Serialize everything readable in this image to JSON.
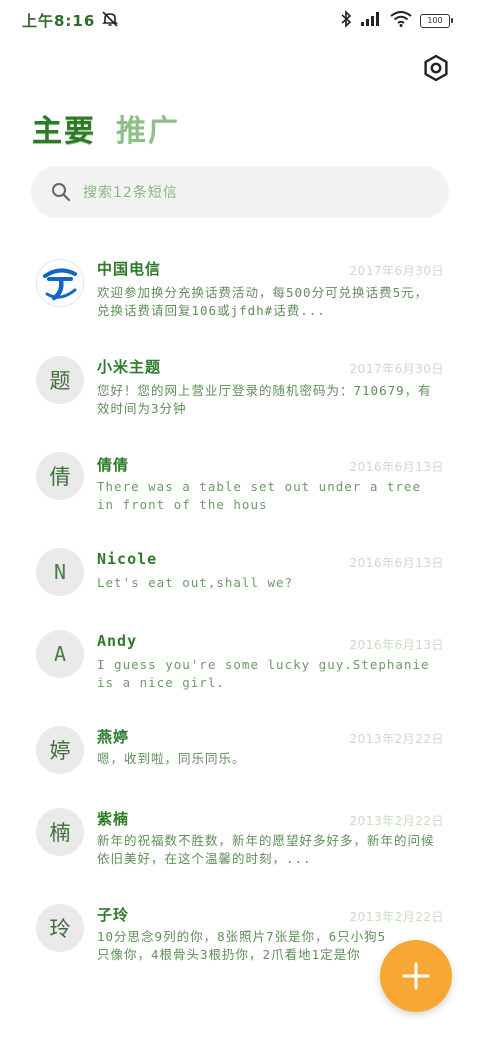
{
  "status_bar": {
    "time": "上午8:16",
    "battery": "100",
    "icons": [
      "mute-icon",
      "bluetooth-icon",
      "signal-icon",
      "wifi-icon",
      "battery-icon"
    ]
  },
  "header": {
    "settings_icon": "gear-icon"
  },
  "tabs": [
    {
      "label": "主要",
      "active": true
    },
    {
      "label": "推广",
      "active": false
    }
  ],
  "search": {
    "placeholder": "搜索12条短信"
  },
  "conversations": [
    {
      "avatar": "",
      "avatar_type": "telecom-logo",
      "name": "中国电信",
      "date": "2017年6月30日",
      "message": "欢迎参加换分充换话费活动，每500分可兑换话费5元，兑换话费请回复106或jfdh#话费..."
    },
    {
      "avatar": "题",
      "name": "小米主题",
      "date": "2017年6月30日",
      "message": "您好！您的网上营业厅登录的随机密码为：710679，有效时间为3分钟"
    },
    {
      "avatar": "倩",
      "name": "倩倩",
      "date": "2016年6月13日",
      "message": "There was a table set out under a tree in front of the hous"
    },
    {
      "avatar": "N",
      "name": "Nicole",
      "date": "2016年6月13日",
      "message": "Let's eat out,shall we?"
    },
    {
      "avatar": "A",
      "name": "Andy",
      "date": "2016年6月13日",
      "message": "I guess you're some lucky guy.Stephanie is a nice girl."
    },
    {
      "avatar": "婷",
      "name": "燕婷",
      "date": "2013年2月22日",
      "message": "嗯，收到啦，同乐同乐。"
    },
    {
      "avatar": "楠",
      "name": "紫楠",
      "date": "2013年2月22日",
      "message": "新年的祝福数不胜数，新年的愿望好多好多，新年的问候依旧美好，在这个温馨的时刻，..."
    },
    {
      "avatar": "玲",
      "name": "子玲",
      "date": "2013年2月22日",
      "message": "10分思念9列的你，8张照片7张是你，6只小狗5只像你，4根骨头3根扔你，2爪看地1定是你"
    }
  ],
  "fab": {
    "icon": "plus-icon",
    "color": "#f8a832"
  }
}
